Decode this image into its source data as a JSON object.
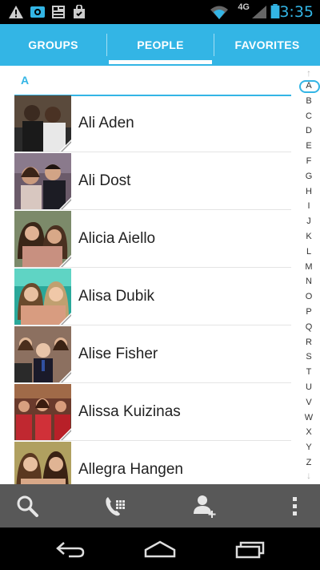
{
  "status_bar": {
    "time": "3:35",
    "network": "4G",
    "icons": [
      "warning-icon",
      "camera-notification-icon",
      "news-notification-icon",
      "shopping-bag-icon",
      "wifi-icon",
      "signal-icon",
      "battery-icon"
    ],
    "time_color": "#33b5e5"
  },
  "tabs": [
    {
      "label": "GROUPS",
      "active": false
    },
    {
      "label": "PEOPLE",
      "active": true
    },
    {
      "label": "FAVORITES",
      "active": false
    }
  ],
  "section": {
    "letter": "A"
  },
  "contacts": [
    {
      "name": "Ali Aden"
    },
    {
      "name": "Ali Dost"
    },
    {
      "name": "Alicia Aiello"
    },
    {
      "name": "Alisa Dubik"
    },
    {
      "name": "Alise Fisher"
    },
    {
      "name": "Alissa Kuizinas"
    },
    {
      "name": "Allegra Hangen"
    }
  ],
  "index": {
    "letters": [
      "A",
      "B",
      "C",
      "D",
      "E",
      "F",
      "G",
      "H",
      "I",
      "J",
      "K",
      "L",
      "M",
      "N",
      "O",
      "P",
      "Q",
      "R",
      "S",
      "T",
      "U",
      "V",
      "W",
      "X",
      "Y",
      "Z"
    ],
    "selected": "A"
  },
  "action_bar": {
    "buttons": [
      "search-icon",
      "dialpad-icon",
      "add-contact-icon",
      "overflow-menu-icon"
    ]
  },
  "nav_bar": {
    "buttons": [
      "back-icon",
      "home-icon",
      "recent-apps-icon"
    ]
  },
  "colors": {
    "accent": "#33b5e5",
    "action_bar": "#585858"
  }
}
